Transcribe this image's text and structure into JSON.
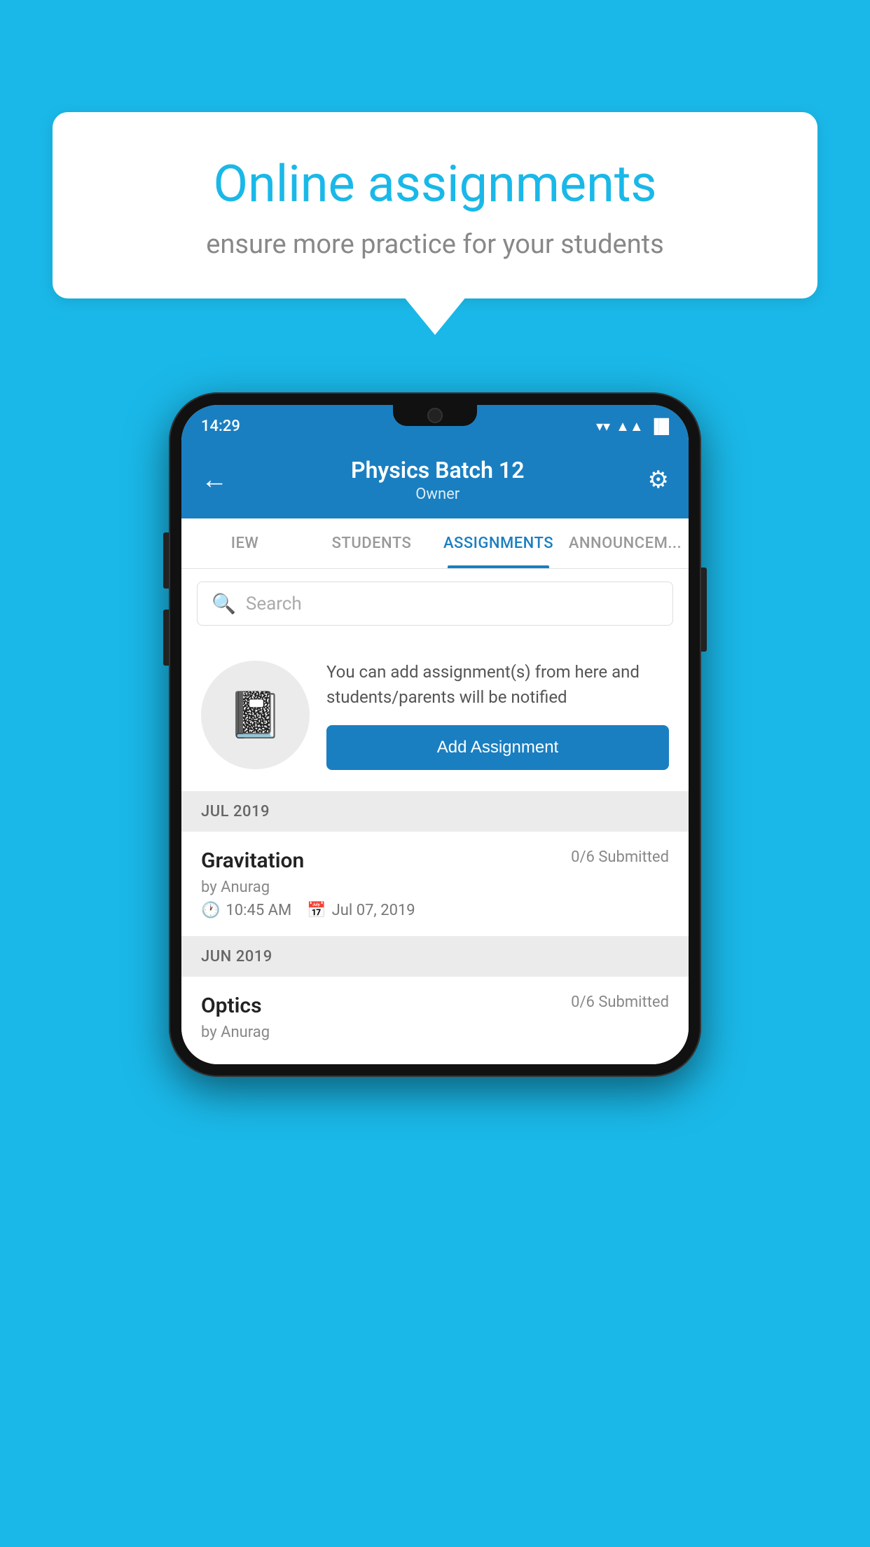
{
  "background_color": "#1ab8e8",
  "speech_bubble": {
    "title": "Online assignments",
    "subtitle": "ensure more practice for your students"
  },
  "phone": {
    "status_bar": {
      "time": "14:29",
      "wifi": "▼",
      "signal": "▲",
      "battery": "▌"
    },
    "app_bar": {
      "back_label": "←",
      "title": "Physics Batch 12",
      "subtitle": "Owner",
      "settings_label": "⚙"
    },
    "tabs": [
      {
        "label": "IEW",
        "active": false
      },
      {
        "label": "STUDENTS",
        "active": false
      },
      {
        "label": "ASSIGNMENTS",
        "active": true
      },
      {
        "label": "ANNOUNCEM...",
        "active": false
      }
    ],
    "search": {
      "placeholder": "Search",
      "icon": "🔍"
    },
    "promo": {
      "icon": "📓",
      "text": "You can add assignment(s) from here and students/parents will be notified",
      "button_label": "Add Assignment"
    },
    "sections": [
      {
        "header": "JUL 2019",
        "assignments": [
          {
            "name": "Gravitation",
            "submitted": "0/6 Submitted",
            "by": "by Anurag",
            "time": "10:45 AM",
            "date": "Jul 07, 2019"
          }
        ]
      },
      {
        "header": "JUN 2019",
        "assignments": [
          {
            "name": "Optics",
            "submitted": "0/6 Submitted",
            "by": "by Anurag",
            "time": "",
            "date": ""
          }
        ]
      }
    ]
  }
}
